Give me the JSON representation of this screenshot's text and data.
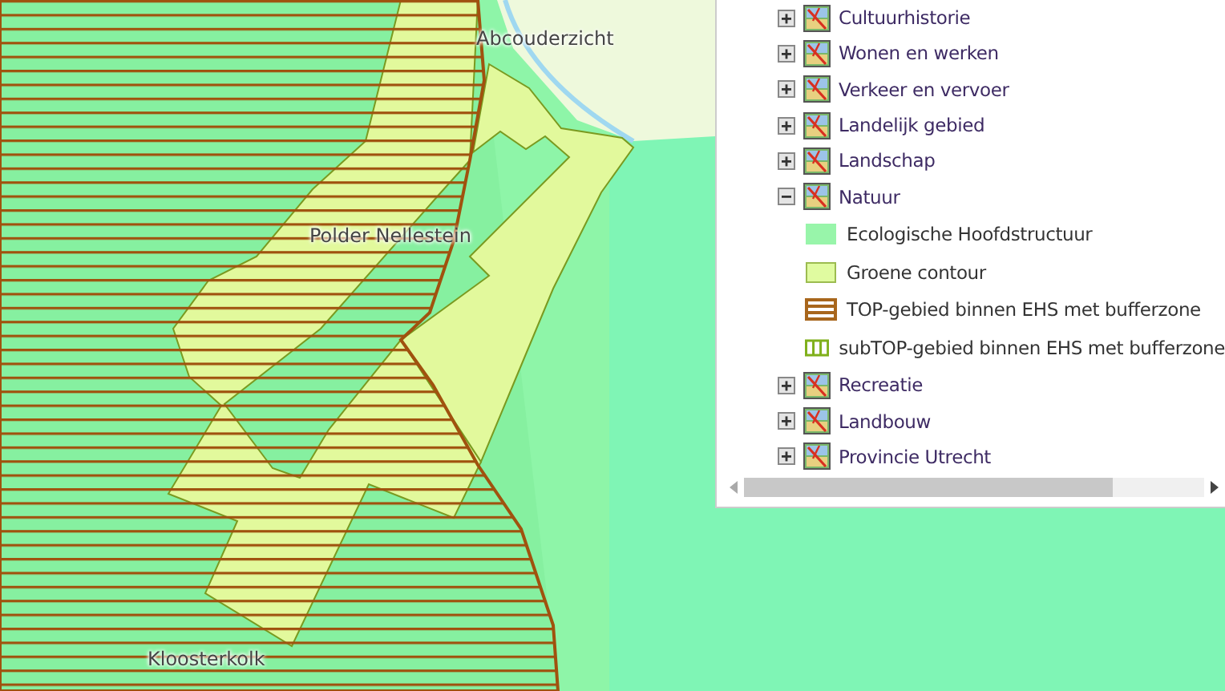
{
  "map": {
    "labels": [
      {
        "text": "Abcouderzicht"
      },
      {
        "text": "Polder Nellestein"
      },
      {
        "text": "Kloosterkolk"
      }
    ]
  },
  "layer_panel": {
    "layers": [
      {
        "label": "Cultuurhistorie",
        "expanded": false
      },
      {
        "label": "Wonen en werken",
        "expanded": false
      },
      {
        "label": "Verkeer en vervoer",
        "expanded": false
      },
      {
        "label": "Landelijk gebied",
        "expanded": false
      },
      {
        "label": "Landschap",
        "expanded": false
      },
      {
        "label": "Natuur",
        "expanded": true,
        "children": [
          {
            "label": "Ecologische Hoofdstructuur",
            "kind": "fill",
            "color": "#98f5aa"
          },
          {
            "label": "Groene contour",
            "kind": "fill",
            "color": "#e0fba0"
          },
          {
            "label": "TOP-gebied binnen EHS met bufferzone",
            "kind": "hatch-h",
            "color": "#a8661c"
          },
          {
            "label": "subTOP-gebied binnen EHS met bufferzone",
            "kind": "hatch-v",
            "color": "#80b01c"
          }
        ]
      },
      {
        "label": "Recreatie",
        "expanded": false
      },
      {
        "label": "Landbouw",
        "expanded": false
      },
      {
        "label": "Provincie Utrecht",
        "expanded": false
      }
    ]
  }
}
